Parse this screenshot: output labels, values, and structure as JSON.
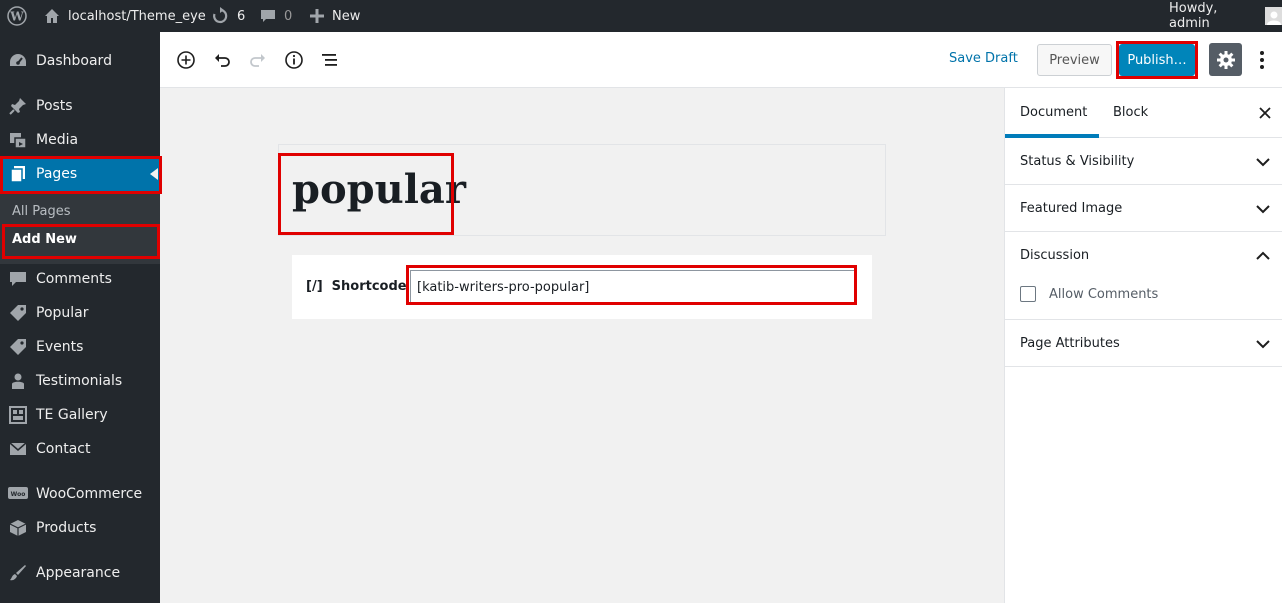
{
  "adminbar": {
    "site_name": "localhost/Theme_eye",
    "updates_count": "6",
    "comments_count": "0",
    "new_label": "New",
    "howdy": "Howdy, admin"
  },
  "sidebar": {
    "items": [
      {
        "label": "Dashboard",
        "icon": "dashboard-icon"
      },
      {
        "label": "Posts",
        "icon": "pin-icon"
      },
      {
        "label": "Media",
        "icon": "media-icon"
      },
      {
        "label": "Pages",
        "icon": "pages-icon"
      },
      {
        "label": "Comments",
        "icon": "comment-icon"
      },
      {
        "label": "Popular",
        "icon": "tag-icon"
      },
      {
        "label": "Events",
        "icon": "tag-icon"
      },
      {
        "label": "Testimonials",
        "icon": "person-icon"
      },
      {
        "label": "TE Gallery",
        "icon": "gallery-icon"
      },
      {
        "label": "Contact",
        "icon": "mail-icon"
      },
      {
        "label": "WooCommerce",
        "icon": "woo-icon"
      },
      {
        "label": "Products",
        "icon": "box-icon"
      },
      {
        "label": "Appearance",
        "icon": "brush-icon"
      }
    ],
    "submenu": {
      "all_pages": "All Pages",
      "add_new": "Add New"
    }
  },
  "toolbar": {
    "save_draft": "Save Draft",
    "preview": "Preview",
    "publish": "Publish…"
  },
  "editor": {
    "title": "popular",
    "shortcode_icon": "[/]",
    "shortcode_label": "Shortcode",
    "shortcode_value": "[katib-writers-pro-popular]"
  },
  "panel": {
    "tabs": {
      "document": "Document",
      "block": "Block"
    },
    "sections": {
      "status": "Status & Visibility",
      "featured": "Featured Image",
      "discussion": "Discussion",
      "allow_comments": "Allow Comments",
      "page_attributes": "Page Attributes"
    }
  },
  "colors": {
    "admin_dark": "#23282d",
    "accent": "#0073aa",
    "publish": "#0085ba",
    "highlight": "#e00000"
  }
}
